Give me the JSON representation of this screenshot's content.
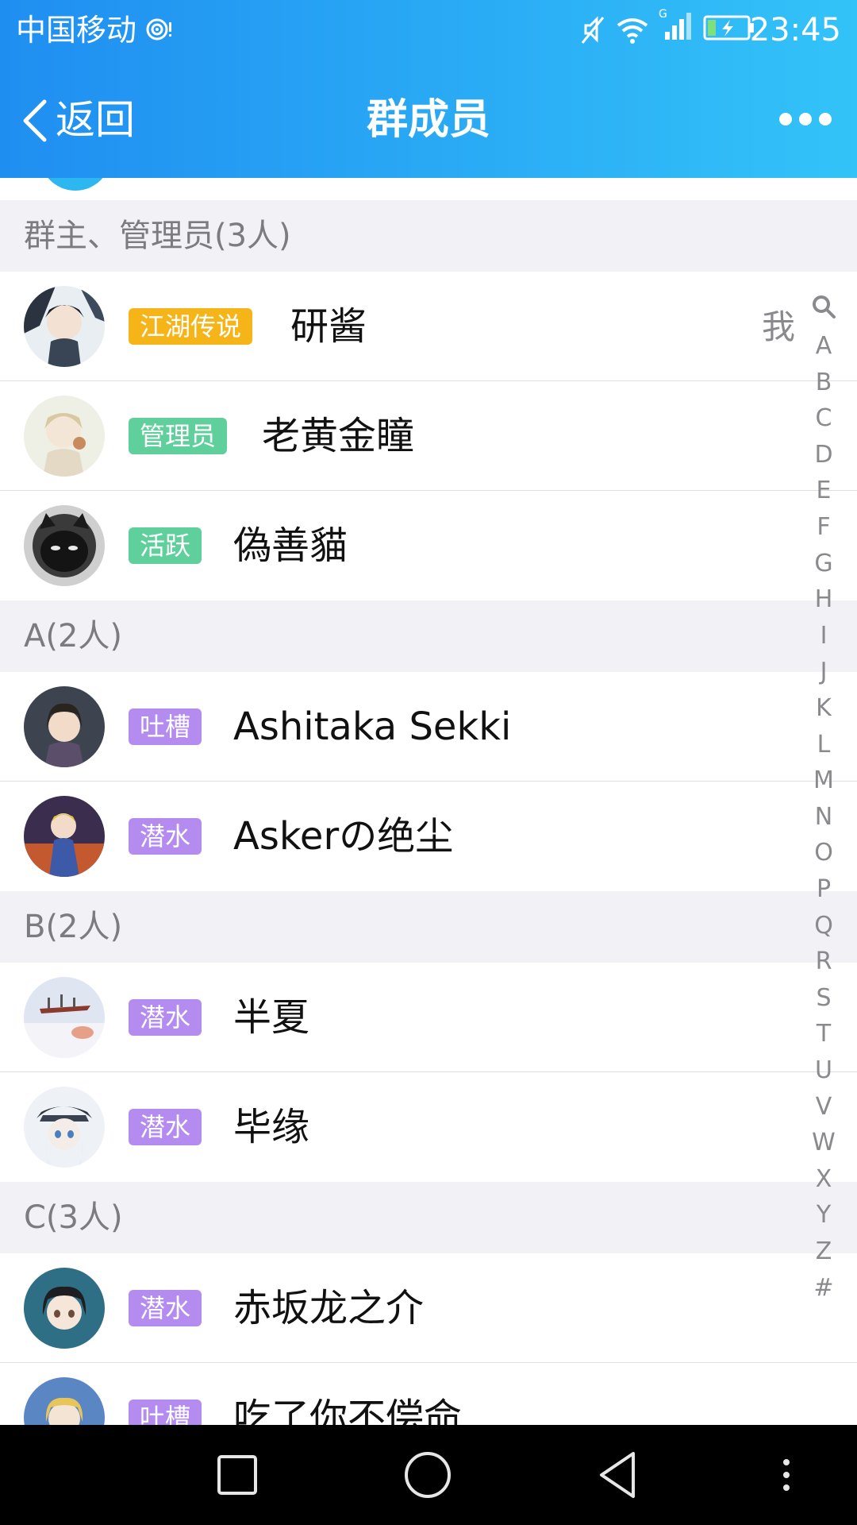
{
  "status_bar": {
    "carrier": "中国移动",
    "network_type": "G",
    "time": "23:45",
    "icons": [
      "hotspot-icon",
      "mute-icon",
      "wifi-icon",
      "signal-icon",
      "battery-charging-icon"
    ]
  },
  "header": {
    "back_label": "返回",
    "title": "群成员",
    "more_icon": "more-icon"
  },
  "sections": [
    {
      "label": "群主、管理员(3人)"
    },
    {
      "label": "A(2人)"
    },
    {
      "label": "B(2人)"
    },
    {
      "label": "C(3人)"
    }
  ],
  "members": [
    {
      "badge": "江湖传说",
      "badge_color": "#f5b418",
      "name": "研酱",
      "me": "我"
    },
    {
      "badge": "管理员",
      "badge_color": "#5fcf9c",
      "name": "老黄金瞳"
    },
    {
      "badge": "活跃",
      "badge_color": "#5fcf9c",
      "name": "偽善貓"
    },
    {
      "badge": "吐槽",
      "badge_color": "#b48cf0",
      "name": "Ashitaka Sekki"
    },
    {
      "badge": "潜水",
      "badge_color": "#b48cf0",
      "name": "Askerの绝尘"
    },
    {
      "badge": "潜水",
      "badge_color": "#b48cf0",
      "name": "半夏"
    },
    {
      "badge": "潜水",
      "badge_color": "#b48cf0",
      "name": "毕缘"
    },
    {
      "badge": "潜水",
      "badge_color": "#b48cf0",
      "name": "赤坂龙之介"
    },
    {
      "badge": "吐槽",
      "badge_color": "#b48cf0",
      "name": "吃了你不偿命"
    }
  ],
  "index_bar": {
    "search_icon": "search-icon",
    "letters": [
      "A",
      "B",
      "C",
      "D",
      "E",
      "F",
      "G",
      "H",
      "I",
      "J",
      "K",
      "L",
      "M",
      "N",
      "O",
      "P",
      "Q",
      "R",
      "S",
      "T",
      "U",
      "V",
      "W",
      "X",
      "Y",
      "Z",
      "#"
    ]
  },
  "nav_bar": {
    "icons": [
      "recent-apps-icon",
      "home-icon",
      "back-icon",
      "menu-icon"
    ]
  },
  "colors": {
    "header_gradient_start": "#1f8ef1",
    "header_gradient_end": "#33c3f8",
    "section_bg": "#f2f2f6"
  }
}
